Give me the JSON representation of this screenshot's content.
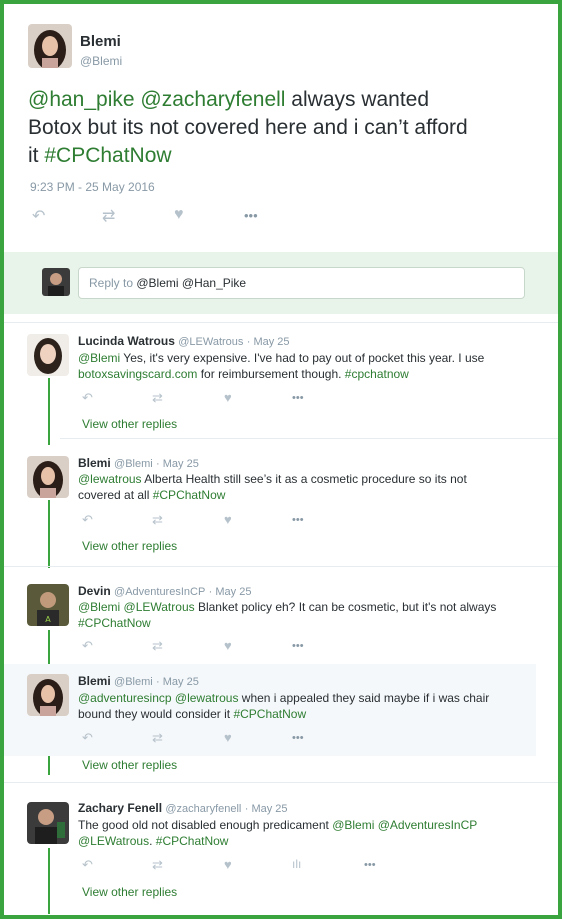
{
  "main_tweet": {
    "name": "Blemi",
    "handle": "@Blemi",
    "mention1": "@han_pike",
    "mention2": "@zacharyfenell",
    "text_line1_rest": " always wanted",
    "text_line2": "Botox but its not covered here and i can’t afford",
    "text_line3_pre": "it ",
    "hashtag": "#CPChatNow",
    "timestamp": "9:23 PM - 25 May 2016",
    "icons": [
      "reply-icon",
      "retweet-icon",
      "like-icon",
      "more-icon"
    ]
  },
  "reply_box": {
    "placeholder_prefix": "Reply to ",
    "mention1": "@Blemi",
    "mention2": "@Han_Pike"
  },
  "replies": [
    {
      "name": "Lucinda Watrous",
      "handle": "@LEWatrous",
      "date": "· May 25",
      "line1_link": "@Blemi",
      "line1_text": " Yes, it's very expensive. I've had to pay out of pocket this year. I use",
      "line2_link": "botoxsavingscard.com",
      "line2_text": " for reimbursement though. ",
      "line2_tag": "#cpchatnow",
      "view_more": "View other replies"
    },
    {
      "name": "Blemi",
      "handle": "@Blemi",
      "date": "· May 25",
      "line1_link": "@lewatrous",
      "line1_text": " Alberta Health still see’s it as a cosmetic procedure so its not",
      "line2_text": "covered at all ",
      "line2_tag": "#CPChatNow",
      "view_more": "View other replies"
    },
    {
      "name": "Devin",
      "handle": "@AdventuresInCP",
      "date": "· May 25",
      "line1_link": "@Blemi @LEWatrous",
      "line1_text": " Blanket policy eh? It can be cosmetic, but it's not always",
      "line2_tag": "#CPChatNow"
    },
    {
      "name": "Blemi",
      "handle": "@Blemi",
      "date": "· May 25",
      "line1_link": "@adventuresincp @lewatrous",
      "line1_text": " when i appealed they said maybe if i was chair",
      "line2_text": "bound they would consider it ",
      "line2_tag": "#CPChatNow",
      "view_more": "View other replies"
    },
    {
      "name": "Zachary Fenell",
      "handle": "@zacharyfenell",
      "date": "· May 25",
      "line1_text": "The good old not disabled enough predicament ",
      "line1_link": "@Blemi @AdventuresInCP",
      "line2_link": "@LEWatrous",
      "line2_text": ". ",
      "line2_tag": "#CPChatNow",
      "view_more": "View other replies"
    }
  ],
  "glyphs": {
    "reply": "↶",
    "retweet": "⇄",
    "like": "♥",
    "more": "•••",
    "analytics": "ılı"
  }
}
